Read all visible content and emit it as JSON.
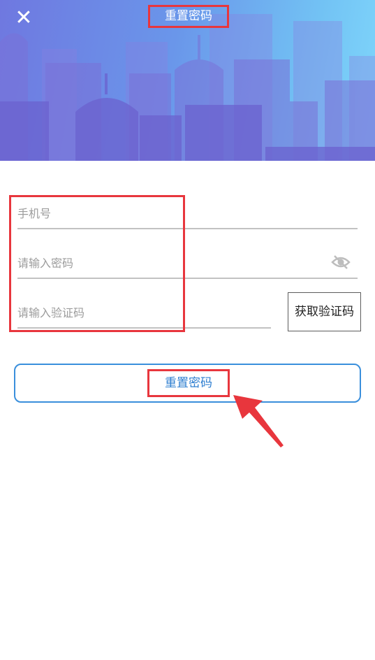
{
  "header": {
    "title": "重置密码",
    "close_icon": "close-icon",
    "gradient": [
      "#6f78e0",
      "#7fd6fb"
    ]
  },
  "form": {
    "phone": {
      "placeholder": "手机号",
      "value": ""
    },
    "password": {
      "placeholder": "请输入密码",
      "value": "",
      "visibility_icon": "eye-off-icon"
    },
    "code": {
      "placeholder": "请输入验证码",
      "value": ""
    },
    "get_code_label": "获取验证码",
    "submit_label": "重置密码"
  },
  "annotations": {
    "highlight_color": "#e8363d",
    "arrow_icon": "red-arrow-icon"
  }
}
